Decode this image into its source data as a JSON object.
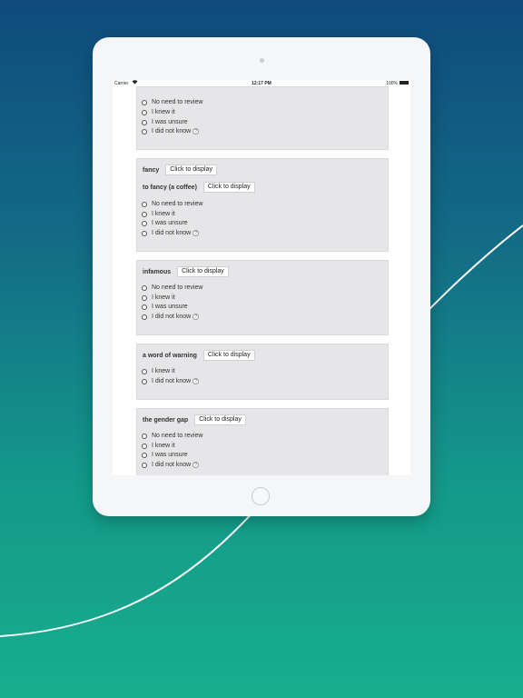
{
  "status_bar": {
    "carrier": "Carrier",
    "wifi_icon": "wifi-icon",
    "time": "12:17 PM",
    "battery": "100%"
  },
  "cards": [
    {
      "partial": true,
      "options": [
        "No need to review",
        "I knew it",
        "I was unsure",
        "I did not know"
      ]
    },
    {
      "rows": [
        {
          "word": "fancy",
          "button": "Click to display"
        },
        {
          "word": "to fancy (a coffee)",
          "button": "Click to display"
        }
      ],
      "options": [
        "No need to review",
        "I knew it",
        "I was unsure",
        "I did not know"
      ]
    },
    {
      "rows": [
        {
          "word": "infamous",
          "button": "Click to display"
        }
      ],
      "options": [
        "No need to review",
        "I knew it",
        "I was unsure",
        "I did not know"
      ]
    },
    {
      "rows": [
        {
          "word": "a word of warning",
          "button": "Click to display"
        }
      ],
      "options": [
        "I knew it",
        "I did not know"
      ]
    },
    {
      "rows": [
        {
          "word": "the gender gap",
          "button": "Click to display"
        }
      ],
      "options": [
        "No need to review",
        "I knew it",
        "I was unsure",
        "I did not know"
      ]
    }
  ],
  "help_symbol": "?"
}
